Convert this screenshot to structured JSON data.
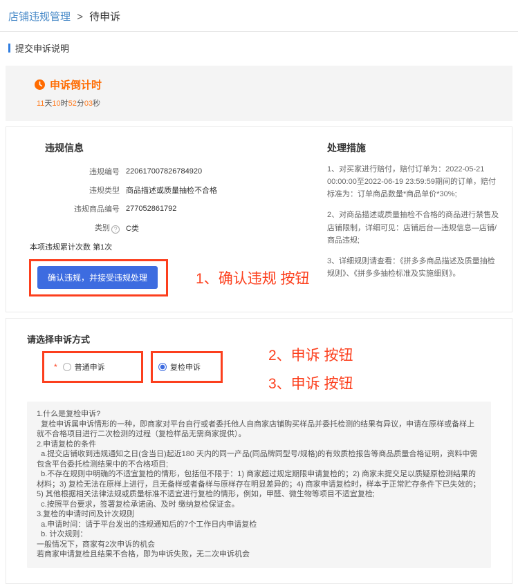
{
  "breadcrumb": {
    "parent": "店铺违规管理",
    "separator": ">",
    "current": "待申诉"
  },
  "section_title": "提交申诉说明",
  "countdown": {
    "title": "申诉倒计时",
    "time": {
      "days": "11",
      "days_unit": "天",
      "hours": "10",
      "hours_unit": "时",
      "minutes": "52",
      "minutes_unit": "分",
      "seconds": "03",
      "seconds_unit": "秒"
    }
  },
  "violation_info": {
    "title": "违规信息",
    "help_glyph": "?",
    "fields": [
      {
        "label": "违规编号",
        "value": "220617007826784920"
      },
      {
        "label": "违规类型",
        "value": "商品描述或质量抽检不合格"
      },
      {
        "label": "违规商品编号",
        "value": "277052861792"
      },
      {
        "label": "类别",
        "value": "C类"
      }
    ],
    "count_label": "本项违规累计次数",
    "count_value": "第1次",
    "confirm_button": "确认违规，并接受违规处理"
  },
  "handling": {
    "title": "处理措施",
    "items": [
      "1、对买家进行赔付，赔付订单为：2022-05-21 00:00:00至2022-06-19 23:59:59期间的订单，赔付标准为：订单商品数量*商品单价*30%;",
      "2、对商品描述或质量抽检不合格的商品进行禁售及店铺限制，详细可见：店铺后台—违规信息—店铺/商品违规;",
      "3、详细规则请查看：《拼多多商品描述及质量抽检规则》、《拼多多抽检标准及实施细则》。"
    ]
  },
  "appeal": {
    "title": "请选择申诉方式",
    "required_mark": "*",
    "options": [
      {
        "label": "普通申诉",
        "selected": false
      },
      {
        "label": "复检申诉",
        "selected": true
      }
    ]
  },
  "annotations": {
    "confirm": "1、确认违规 按钮",
    "option1": "2、申诉 按钮",
    "option2": "3、申诉 按钮"
  },
  "notice": {
    "lines": [
      "1.什么是复检申诉?",
      "  复检申诉属申诉情形的一种，即商家对平台自行或者委托他人自商家店铺购买样品并委托检测的结果有异议，申请在原样或备样上就不合格项目进行二次检测的过程（复检样品无需商家提供）。",
      "2.申请复检的条件",
      "  a.提交店铺收到违规通知之日(含当日)起近180 天内的同一产品(同品牌同型号/规格)的有效质检报告等商品质量合格证明，资料中需包含平台委托检测结果中的不合格项目;",
      "  b.不存在规则中明确的不适宜复检的情形，包括但不限于：1) 商家超过规定期限申请复检的；2) 商家未提交足以质疑原检测结果的材料；3) 复检无法在原样上进行，且无备样或者备样与原样存在明显差异的；4) 商家申请复检时，样本于正常贮存条件下已失效的；5) 其他根据相关法律法规或质量标准不适宜进行复检的情形，例如，甲醛、微生物等项目不适宜复检;",
      "  c.按照平台要求，签署复检承诺函、及时 缴纳复检保证金。",
      "3.复检的申请时间及计次规则",
      "  a.申请时间：请于平台发出的违规通知后的7个工作日内申请复检",
      "  b. 计次规则：",
      "一般情况下，商家有2次申诉的机会",
      "若商家申请复检且结果不合格，即为申诉失败，无二次申诉机会"
    ]
  },
  "colors": {
    "breadcrumb_blue": "#4688c7",
    "accent_blue": "#3d6ce0",
    "orange": "#ff6b00",
    "annotation_red": "#fc3f1d"
  }
}
